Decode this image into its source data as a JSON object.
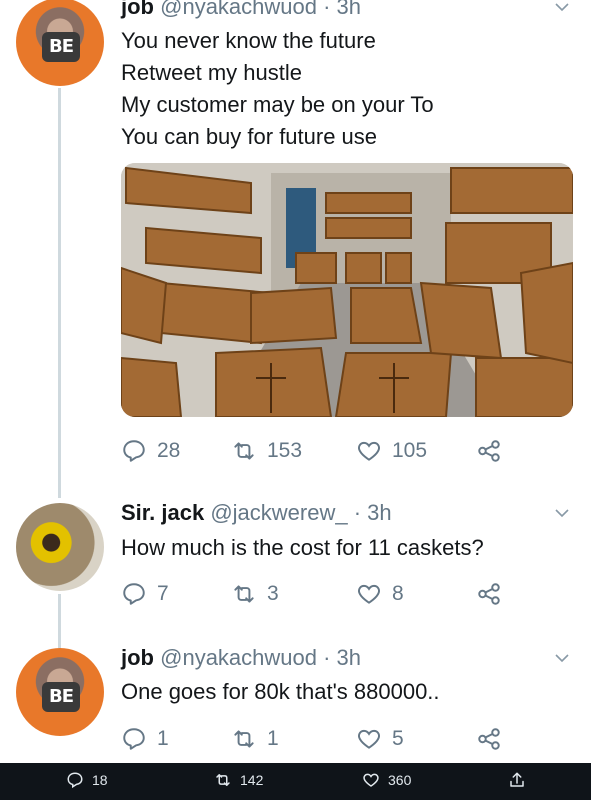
{
  "tweets": [
    {
      "name": "job",
      "meta": "@nyakachwuod · 3h",
      "lines": [
        "You never know the future",
        "Retweet my hustle",
        "My customer may be on your To",
        "You can buy for future use"
      ],
      "has_media": true,
      "replies": "28",
      "retweets": "153",
      "likes": "105"
    },
    {
      "name": "Sir. jack",
      "meta": "@jackwerew_ · 3h",
      "lines": [
        "How much is the cost for 11 caskets?"
      ],
      "replies": "7",
      "retweets": "3",
      "likes": "8"
    },
    {
      "name": "job",
      "meta": "@nyakachwuod · 3h",
      "lines": [
        "One goes for 80k that's 880000.."
      ],
      "replies": "1",
      "retweets": "1",
      "likes": "5"
    }
  ],
  "avatar_badge": "BE",
  "bottom_bar": {
    "replies": "18",
    "retweets": "142",
    "likes": "360"
  },
  "colors": {
    "muted": "#657786",
    "thread_line": "#cfd9de",
    "bar": "#0f1419"
  },
  "icons": [
    "reply-icon",
    "retweet-icon",
    "like-icon",
    "share-icon",
    "chevron-down-icon",
    "upload-icon"
  ]
}
